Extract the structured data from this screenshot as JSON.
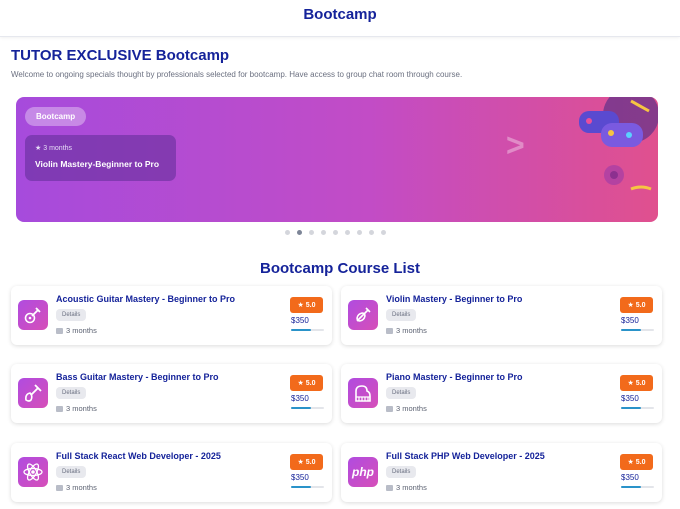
{
  "header": {
    "title": "Bootcamp"
  },
  "exclusive": {
    "title": "TUTOR EXCLUSIVE Bootcamp",
    "description": "Welcome to ongoing specials thought by professionals selected for bootcamp. Have access to group chat room through course."
  },
  "banner": {
    "tag": "Bootcamp",
    "duration": "3 months",
    "course": "Violin Mastery-Beginner to Pro",
    "total_slides": 9,
    "active_slide": 2
  },
  "course_list": {
    "title": "Bootcamp Course List",
    "details_label": "Details",
    "courses": [
      {
        "title": "Acoustic Guitar Mastery - Beginner to Pro",
        "duration": "3 months",
        "rating": "5.0",
        "price": "$350",
        "progress": 0.6,
        "icon": "guitar-icon"
      },
      {
        "title": "Violin Mastery - Beginner to Pro",
        "duration": "3 months",
        "rating": "5.0",
        "price": "$350",
        "progress": 0.6,
        "icon": "violin-icon"
      },
      {
        "title": "Bass Guitar Mastery - Beginner to Pro",
        "duration": "3 months",
        "rating": "5.0",
        "price": "$350",
        "progress": 0.6,
        "icon": "bass-guitar-icon"
      },
      {
        "title": "Piano Mastery - Beginner to Pro",
        "duration": "3 months",
        "rating": "5.0",
        "price": "$350",
        "progress": 0.6,
        "icon": "piano-icon"
      },
      {
        "title": "Full Stack React Web Developer - 2025",
        "duration": "3 months",
        "rating": "5.0",
        "price": "$350",
        "progress": 0.6,
        "icon": "react-icon"
      },
      {
        "title": "Full Stack PHP Web Developer - 2025",
        "duration": "3 months",
        "rating": "5.0",
        "price": "$350",
        "progress": 0.6,
        "icon": "php-icon",
        "icon_text": "php"
      }
    ]
  },
  "colors": {
    "primary": "#15239a",
    "accent": "#f26a1b",
    "banner_start": "#a64bdc",
    "banner_end": "#e0508e"
  }
}
